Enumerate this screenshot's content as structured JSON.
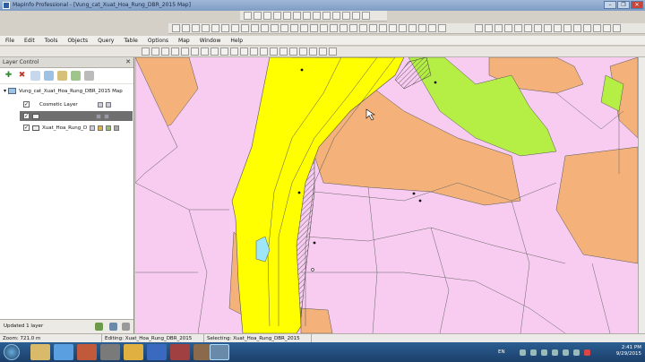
{
  "window": {
    "title": "MapInfo Professional - [Vung_cat_Xuat_Hoa_Rung_DBR_2015 Map]",
    "controls": [
      "–",
      "❐",
      "✕"
    ]
  },
  "menu": {
    "items": [
      "File",
      "Edit",
      "Tools",
      "Objects",
      "Query",
      "Table",
      "Options",
      "Map",
      "Window",
      "Help"
    ]
  },
  "layer_control": {
    "title": "Layer Control",
    "close": "✕",
    "map_name": "Vung_cat_Xuat_Hoa_Rung_DBR_2015 Map",
    "layers": [
      {
        "label": "Cosmetic Layer",
        "checked": true
      },
      {
        "label": "",
        "checked": true,
        "selected": true
      },
      {
        "label": "Xuat_Hoa_Rung_D",
        "checked": true
      }
    ],
    "status": "Updated 1 layer"
  },
  "status_bar": {
    "zoom": "Zoom: 721.0 m",
    "editing": "Editing: Xuat_Hoa_Rung_DBR_2015",
    "selecting": "Selecting: Xuat_Hoa_Rung_DBR_2015"
  },
  "taskbar": {
    "language": "EN",
    "time": "2:41 PM",
    "date": "9/29/2015"
  },
  "colors": {
    "forest_yellow": "#ffff00",
    "orange_parcel": "#f4b27a",
    "pink_parcel": "#f7ccf0",
    "green_parcel": "#b5ef45",
    "water": "#9ee5f5"
  }
}
